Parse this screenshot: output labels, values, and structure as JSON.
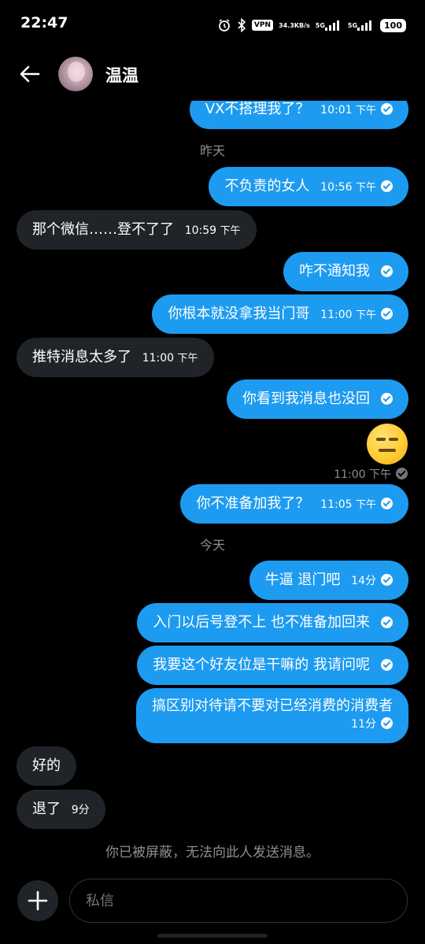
{
  "status_bar": {
    "time": "22:47",
    "net_speed_value": "34.3",
    "net_speed_unit": "KB/s",
    "vpn_label": "VPN",
    "network_1": "5G",
    "network_2": "5G",
    "battery": "100",
    "icons": [
      "alarm-icon",
      "bluetooth-icon",
      "vpn-icon",
      "signal-icon",
      "signal-icon",
      "battery-icon"
    ]
  },
  "header": {
    "contact_name": "温温",
    "back_icon": "arrow-left-icon"
  },
  "messages": [
    {
      "direction": "out",
      "text": "VX不搭理我了？",
      "time": "10:01",
      "ampm": "下午",
      "read": true
    },
    {
      "type": "day",
      "text": "昨天"
    },
    {
      "direction": "out",
      "text": "不负责的女人",
      "time": "10:56",
      "ampm": "下午",
      "read": true
    },
    {
      "direction": "in",
      "text": "那个微信……登不了了",
      "time": "10:59",
      "ampm": "下午"
    },
    {
      "direction": "out",
      "text": "咋不通知我",
      "read": true
    },
    {
      "direction": "out",
      "text": "你根本就没拿我当门哥",
      "time": "11:00",
      "ampm": "下午",
      "read": true
    },
    {
      "direction": "in",
      "text": "推特消息太多了",
      "time": "11:00",
      "ampm": "下午"
    },
    {
      "direction": "out",
      "text": "你看到我消息也没回",
      "read": true
    },
    {
      "direction": "out",
      "type": "emoji",
      "emoji": "neutral-face-emoji",
      "time": "11:00",
      "ampm": "下午",
      "read": true
    },
    {
      "direction": "out",
      "text": "你不准备加我了？",
      "time": "11:05",
      "ampm": "下午",
      "read": true
    },
    {
      "type": "day",
      "text": "今天"
    },
    {
      "direction": "out",
      "text": "牛逼 退门吧",
      "time": "14分",
      "read": true
    },
    {
      "direction": "out",
      "text": "入门以后号登不上 也不准备加回来",
      "read": true
    },
    {
      "direction": "out",
      "text": "我要这个好友位是干嘛的 我请问呢",
      "read": true
    },
    {
      "direction": "out",
      "text": "搞区别对待请不要对已经消费的消费者",
      "time": "11分",
      "read": true
    },
    {
      "direction": "in",
      "text": "好的"
    },
    {
      "direction": "in",
      "text": "退了",
      "time": "9分"
    }
  ],
  "blocked_notice": "你已被屏蔽，无法向此人发送消息。",
  "composer": {
    "placeholder": "私信",
    "add_icon": "plus-icon"
  }
}
